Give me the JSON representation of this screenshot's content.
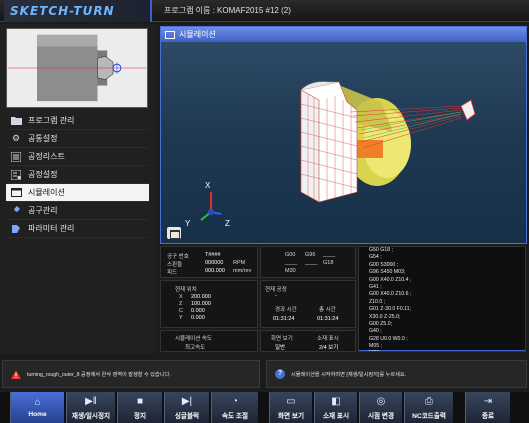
{
  "app": {
    "logo": "SKETCH-TURN",
    "program_label": "프로그램 이름 : KOMAF2015 #12 (2)"
  },
  "sidebar": {
    "items": [
      {
        "label": "프로그램 관리",
        "icon": "folder-icon"
      },
      {
        "label": "공통설정",
        "icon": "gear-icon"
      },
      {
        "label": "공정리스트",
        "icon": "list-icon"
      },
      {
        "label": "공정설정",
        "icon": "settings-list-icon"
      },
      {
        "label": "시뮬레이션",
        "icon": "monitor-icon",
        "active": true
      },
      {
        "label": "공구관리",
        "icon": "tool-icon"
      },
      {
        "label": "파라미터 관리",
        "icon": "parameter-icon"
      }
    ]
  },
  "simulation": {
    "title": "시뮬레이션",
    "axes": {
      "x": "X",
      "y": "Y",
      "z": "Z"
    }
  },
  "tool_info": {
    "tool_no_label": "공구 번호",
    "tool_no_value": "T####",
    "spindle_label": "스핀들",
    "spindle_value": "000000",
    "spindle_unit": "RPM",
    "feed_label": "피드",
    "feed_value": "000.000",
    "feed_unit": "mm/rev"
  },
  "modal_codes": {
    "row1": [
      "G00",
      "G96",
      "____"
    ],
    "row2": [
      "____",
      "____",
      "G18"
    ],
    "row3": [
      "M30",
      "",
      ""
    ]
  },
  "position": {
    "title": "현재 위치",
    "axes": [
      {
        "axis": "X",
        "value": "200.000"
      },
      {
        "axis": "Z",
        "value": "100.000"
      },
      {
        "axis": "C",
        "value": "0.000"
      },
      {
        "axis": "Y",
        "value": "0.000"
      }
    ]
  },
  "process": {
    "title": "현재 공정",
    "value": "-",
    "elapsed_label": "경과 시간",
    "elapsed_value": "01:31:24",
    "total_label": "총 시간",
    "total_value": "01:31:24"
  },
  "speed": {
    "label": "시뮬레이션 속도",
    "value": "최고속도"
  },
  "display": {
    "screen_label": "화면 보기",
    "screen_value": "일반",
    "material_label": "소재 표시",
    "material_value": "2/4 보기"
  },
  "nc_code": [
    "G50 G18 ;",
    "G54 ;",
    "G00 S3000 ;",
    "G96 S450 M03;",
    "G00 X40.0 Z10.4 ;",
    "G41 ;",
    "G00 X40.0 Z10.6 ;",
    "Z10.0 ;",
    "G01 Z-30.0 F0.11;",
    "X30.0 Z-25.0;",
    "G00 Z5.0;",
    "G40 ;",
    "G28 U0.0 W0.0 ;",
    "M05 ;",
    "M30 ;"
  ],
  "active_code_index": 14,
  "messages": {
    "warning": "turning_rough_outer_8 공정에서 완삭 영역이 발생할 수 있습니다.",
    "info": "시뮬레이션을 시작하려면 [재생/일시정지]를 누르세요."
  },
  "toolbar": [
    {
      "label": "Home",
      "icon": "home-icon"
    },
    {
      "label": "재생/일시정지",
      "icon": "play-pause-icon"
    },
    {
      "label": "정지",
      "icon": "stop-icon"
    },
    {
      "label": "싱글블럭",
      "icon": "single-block-icon"
    },
    {
      "label": "속도 조절",
      "icon": "speedometer-icon"
    },
    {
      "label": "화면 보기",
      "icon": "screen-icon"
    },
    {
      "label": "소재 표시",
      "icon": "material-icon"
    },
    {
      "label": "시점 변경",
      "icon": "camera-icon"
    },
    {
      "label": "NC코드출력",
      "icon": "printer-icon"
    },
    {
      "label": "종료",
      "icon": "exit-icon"
    }
  ],
  "colors": {
    "accent": "#4a6fd6",
    "active_code": "#3d62d0",
    "workpiece": "#ffffff",
    "chuck": "#e8e45a",
    "toolpath": "#e0352b",
    "axis_x": "#e03030",
    "axis_y": "#2bbf3a",
    "axis_z": "#3060e0"
  }
}
